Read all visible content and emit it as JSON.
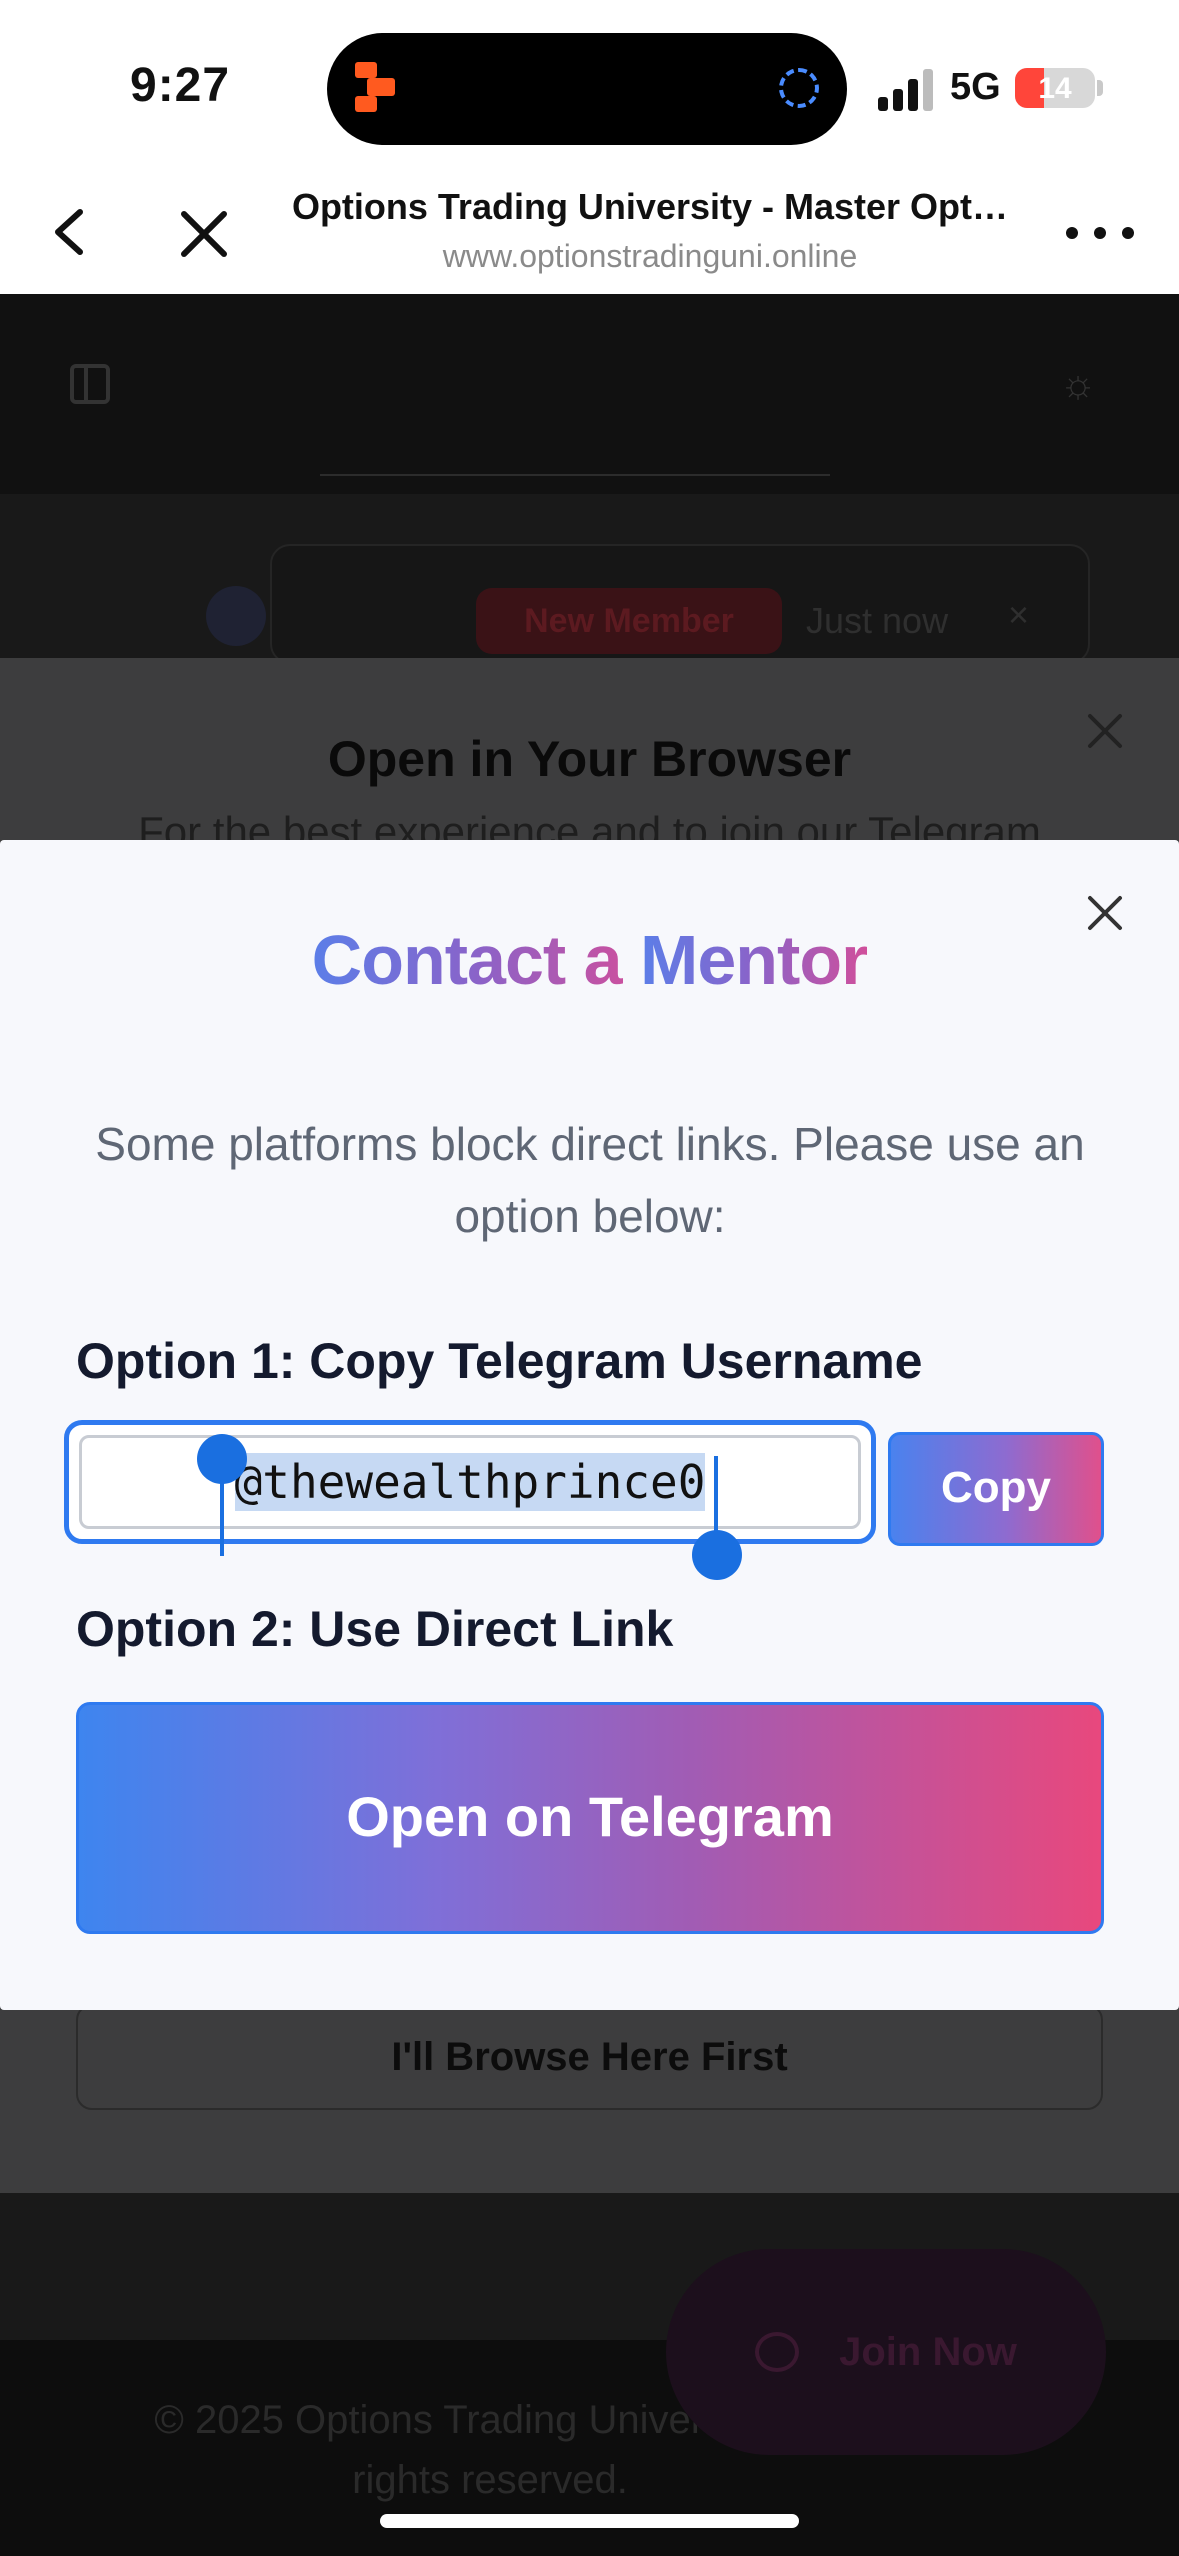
{
  "status_bar": {
    "time": "9:27",
    "network": "5G",
    "battery": "14",
    "battery_level": 0.14,
    "battery_color": "#ff453a",
    "island_app_icon": "orange-app-icon",
    "island_activity_icon": "activity-ring-icon"
  },
  "browser": {
    "page_title": "Options Trading University - Master Opt…",
    "url": "www.optionstradinguni.online",
    "icons": {
      "back": "chevron-left-icon",
      "close": "close-icon",
      "more": "more-dots-icon"
    }
  },
  "background_page": {
    "icons": {
      "sidebar": "sidebar-toggle-icon",
      "theme": "sun-icon",
      "chat": "chat-icon"
    },
    "toast": {
      "badge": "New Member",
      "time": "Just now",
      "close": "×"
    },
    "cta": "Join Now",
    "footer": "© 2025 Options Trading University. All rights reserved."
  },
  "browser_modal": {
    "title": "Open in Your Browser",
    "subtitle": "For the best experience and to join our Telegram",
    "secondary_button": "I'll Browse Here First"
  },
  "mentor_modal": {
    "title_part1": "Contact a ",
    "title_part2": "Mentor",
    "description": "Some platforms block direct links. Please use an option below:",
    "option1_label": "Option 1: Copy Telegram Username",
    "username": "@thewealthprince0",
    "copy_label": "Copy",
    "option2_label": "Option 2: Use Direct Link",
    "open_label": "Open on Telegram",
    "accent_colors": {
      "blue": "#3e85ef",
      "purple": "#8a63c9",
      "pink": "#e8487d"
    }
  }
}
